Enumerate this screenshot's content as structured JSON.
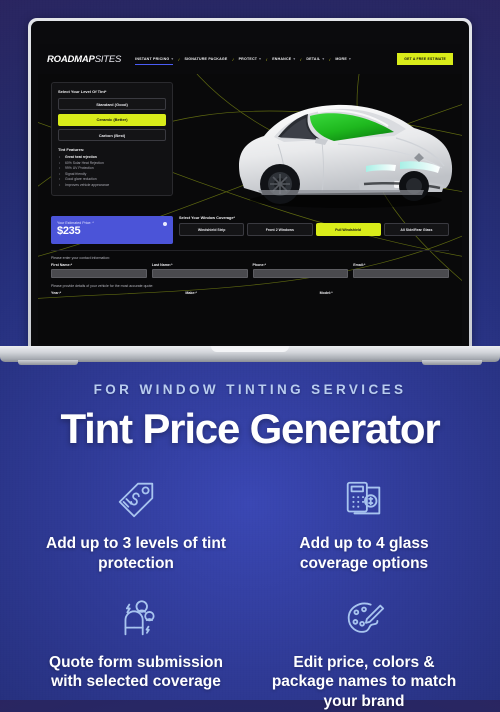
{
  "browser": {
    "brand": "ROADMAP",
    "brand_suffix": "SITES",
    "nav": [
      {
        "label": "INSTANT PRICING",
        "caret": "▾",
        "active": true
      },
      {
        "label": "SIGNATURE PACKAGE",
        "caret": "",
        "active": false
      },
      {
        "label": "PROTECT",
        "caret": "▾",
        "active": false
      },
      {
        "label": "ENHANCE",
        "caret": "▾",
        "active": false
      },
      {
        "label": "DETAIL",
        "caret": "▾",
        "active": false
      },
      {
        "label": "MORE",
        "caret": "▾",
        "active": false
      }
    ],
    "cta": "GET A FREE ESTIMATE"
  },
  "tint": {
    "heading": "Select Your Level Of Tint*",
    "options": [
      {
        "label": "Standard (Good)",
        "selected": false
      },
      {
        "label": "Ceramic (Better)",
        "selected": true
      },
      {
        "label": "Carbon (Best)",
        "selected": false
      }
    ],
    "features_title": "Tint Features:",
    "features": [
      {
        "text": "Great heat rejection",
        "emphasis": true
      },
      {
        "text": "60% Solar Heat Rejection",
        "emphasis": false
      },
      {
        "text": "99% UV Protection",
        "emphasis": false
      },
      {
        "text": "Signal friendly",
        "emphasis": false
      },
      {
        "text": "Good glare reduction",
        "emphasis": false
      },
      {
        "text": "Improves vehicle appearance",
        "emphasis": false
      }
    ]
  },
  "price": {
    "label": "Your Estimated Price: *",
    "value": "$235"
  },
  "coverage": {
    "heading": "Select Your Window Coverage*",
    "options": [
      {
        "label": "Windshield Strip",
        "selected": false
      },
      {
        "label": "Front 2 Windows",
        "selected": false
      },
      {
        "label": "Full Windshield",
        "selected": true
      },
      {
        "label": "All Side/Rear Glass",
        "selected": false
      }
    ]
  },
  "form": {
    "contact_note": "Please enter your contact information:",
    "contact_fields": [
      "First Name:*",
      "Last Name:*",
      "Phone:*",
      "Email:*"
    ],
    "vehicle_note": "Please provide details of your vehicle for the most accurate quote:",
    "vehicle_fields": [
      "Year:*",
      "Make:*",
      "Model:*"
    ]
  },
  "promo": {
    "eyebrow": "FOR WINDOW TINTING SERVICES",
    "title": "Tint Price Generator",
    "features": [
      {
        "icon": "price-tag-icon",
        "text": "Add up to 3 levels of tint protection"
      },
      {
        "icon": "calculator-money-icon",
        "text": "Add up to 4 glass coverage options"
      },
      {
        "icon": "lead-magnet-icon",
        "text": "Quote form submission with selected coverage"
      },
      {
        "icon": "paint-palette-icon",
        "text": "Edit price, colors & package names to match your brand"
      }
    ]
  },
  "colors": {
    "accent_yellow": "#d9ec1a",
    "accent_blue": "#4b54d8",
    "tint_green": "#2bbd2b",
    "bg_dark": "#09090a",
    "promo_bg": "#2f3a96"
  }
}
